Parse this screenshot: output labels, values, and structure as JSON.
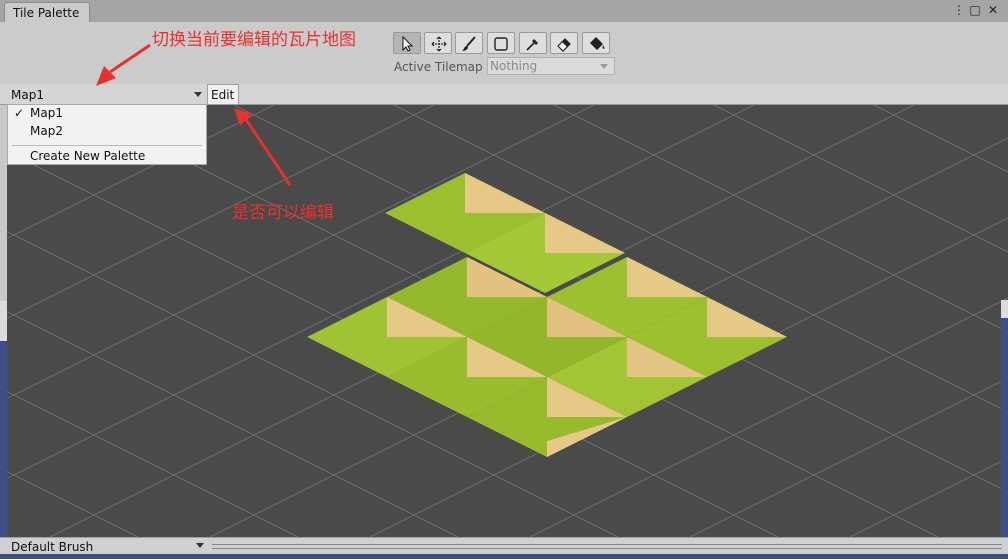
{
  "window": {
    "title": "Tile Palette",
    "menu_glyph": "⋮",
    "maximize_glyph": "□",
    "close_glyph": "✕"
  },
  "toolbar": {
    "tools": [
      "select-icon",
      "move-icon",
      "paintbrush-icon",
      "box-fill-icon",
      "picker-icon",
      "eraser-icon",
      "fill-bucket-icon"
    ],
    "active_tool": "select-icon",
    "active_tilemap_label": "Active Tilemap",
    "active_tilemap_value": "Nothing"
  },
  "palette": {
    "selected": "Map1",
    "edit_label": "Edit",
    "menu": {
      "check_glyph": "✓",
      "items": [
        "Map1",
        "Map2"
      ],
      "create_label": "Create New Palette"
    }
  },
  "brush": {
    "selected": "Default Brush"
  },
  "annotations": {
    "switch_map": "切换当前要编辑的瓦片地图",
    "edit_toggle": "是否可以编辑"
  },
  "colors": {
    "canvas_bg": "#4a4a4a",
    "grid_line": "#6e6e6e",
    "grass": "#9bbf2f",
    "sand": "#e6c887",
    "annotation_red": "#e8312d"
  }
}
